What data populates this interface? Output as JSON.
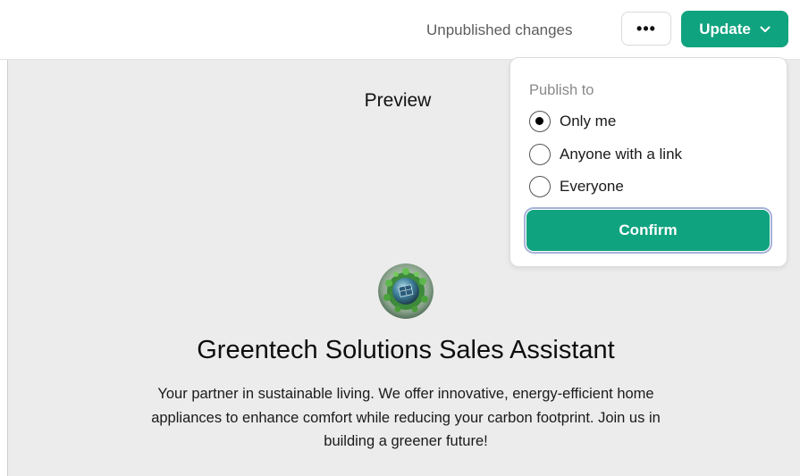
{
  "header": {
    "status_text": "Unpublished changes",
    "more_label": "•••",
    "update_label": "Update"
  },
  "preview": {
    "title": "Preview",
    "gpt_name": "Greentech Solutions Sales Assistant",
    "gpt_description": "Your partner in sustainable living. We offer innovative, energy-efficient home appliances to enhance comfort while reducing your carbon footprint. Join us in building a greener future!"
  },
  "publish": {
    "heading": "Publish to",
    "options": [
      {
        "label": "Only me",
        "selected": true
      },
      {
        "label": "Anyone with a link",
        "selected": false
      },
      {
        "label": "Everyone",
        "selected": false
      }
    ],
    "confirm_label": "Confirm"
  },
  "colors": {
    "accent": "#10a37f",
    "preview_bg": "#ececec",
    "focus_ring": "#a6b3d8"
  },
  "icons": {
    "more": "ellipsis-icon",
    "update_chevron": "chevron-down-icon",
    "avatar": "green-globe-avatar"
  }
}
